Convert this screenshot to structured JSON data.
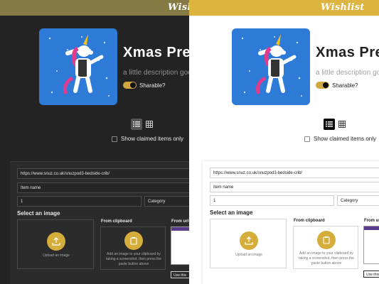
{
  "app": {
    "logo_text": "Wishlist"
  },
  "list": {
    "title": "Xmas Prez",
    "description": "a little description goe",
    "sharable_label": "Sharable?",
    "sharable_on": true
  },
  "view": {
    "list_icon": "list-view-icon",
    "grid_icon": "grid-view-icon",
    "show_claimed_label": "Show claimed items only"
  },
  "form": {
    "url_value": "https://www.snuz.co.uk/snuzpod3-bedside-crib/",
    "name_placeholder": "Item name",
    "quantity_value": "1",
    "category_placeholder": "Category",
    "select_image_label": "Select an image",
    "upload_label": "Upload an image",
    "from_clipboard_label": "From clipboard",
    "clipboard_hint": "Add an image to your clipboard by taking a screenshot, then press the paste button above",
    "from_url_label": "From url",
    "use_this_label": "Use this"
  },
  "colors": {
    "accent": "#d4ad3b",
    "dark_bg": "#232323",
    "topbar_dark": "#857a43",
    "topbar_light": "#dcb43f",
    "art_bg": "#2d7bd6"
  }
}
